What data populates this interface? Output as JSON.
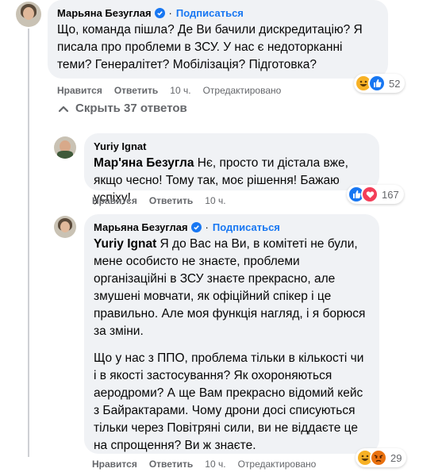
{
  "comments": [
    {
      "author": "Марьяна Безуглая",
      "subscribe": "Подписаться",
      "text": "Що, команда пішла? Де Ви бачили дискредитацію? Я писала про проблеми в ЗСУ. У нас є недоторканні теми? Генералітет? Мобілізація? Підготовка?",
      "actions": {
        "like": "Нравится",
        "reply": "Ответить",
        "time": "10 ч.",
        "edited": "Отредактировано"
      },
      "reaction_count": "52"
    },
    {
      "author": "Yuriy Ignat",
      "mention": "Мар'яна Безугла",
      "text": " Нє, просто ти дістала вже, якщо чесно! Тому так, моє рішення! Бажаю успіху!",
      "actions": {
        "like": "Нравится",
        "reply": "Ответить",
        "time": "10 ч."
      },
      "reaction_count": "167"
    },
    {
      "author": "Марьяна Безуглая",
      "subscribe": "Подписаться",
      "mention": "Yuriy Ignat",
      "text": " Я до Вас на Ви, в комітеті не були, мене особисто не знаєте, проблеми організаційні в ЗСУ знаєте прекрасно, але змушені мовчати, як офіційний спікер і це правильно. Але моя функція нагляд, і я борюся за зміни.",
      "text2": "Що у нас з ППО, проблема тільки в кількості чи і в якості застосування? Як охороняються аеродроми? А ще Вам прекрасно відомий кейс з Байрактарами. Чому дрони досі списуються тільки через Повітряні сили, ви не віддаєте це на спрощення? Ви ж знаєте.",
      "actions": {
        "like": "Нравится",
        "reply": "Ответить",
        "time": "10 ч.",
        "edited": "Отредактировано"
      },
      "reaction_count": "29"
    }
  ],
  "hide_replies": "Скрыть 37 ответов",
  "colors": {
    "link": "#1877f2",
    "bubble": "#f0f2f5",
    "meta": "#65676b",
    "haha": "#f7b125",
    "like": "#1877f2",
    "love": "#f33e58",
    "angry": "#e9710f"
  }
}
